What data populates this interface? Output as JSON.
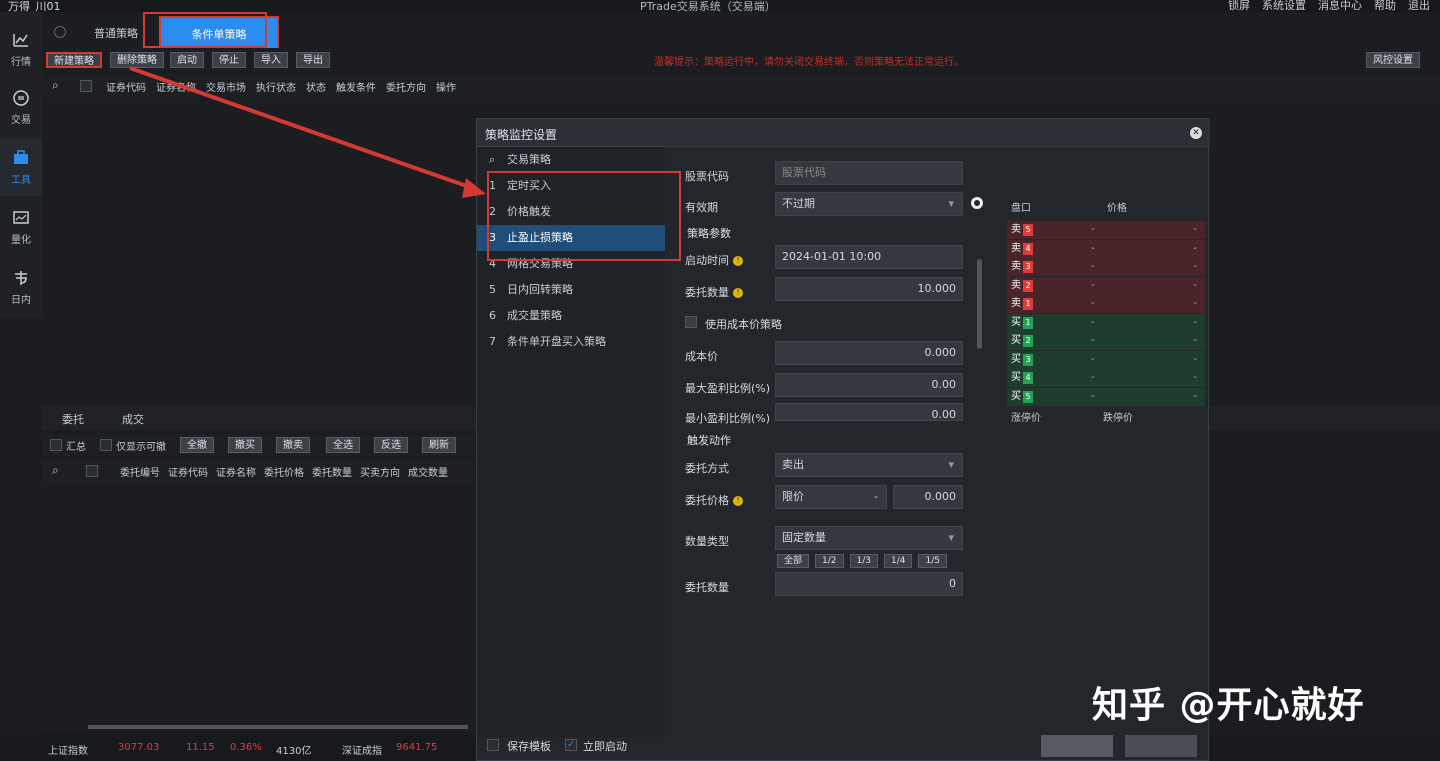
{
  "titlebar": {
    "app_name": "万得_川01",
    "window_title": "PTrade交易系统（交易端）",
    "menu": [
      "锁屏",
      "系统设置",
      "消息中心",
      "帮助",
      "退出"
    ]
  },
  "nav": [
    {
      "label": "行情",
      "icon": "chart-icon"
    },
    {
      "label": "交易",
      "icon": "exchange-icon"
    },
    {
      "label": "工具",
      "icon": "toolbox-icon"
    },
    {
      "label": "量化",
      "icon": "quant-icon"
    },
    {
      "label": "日内",
      "icon": "intraday-icon"
    }
  ],
  "tabs": {
    "tab1": "普通策略",
    "tab2_active": "条件单策略"
  },
  "toolbar": {
    "buttons": [
      "新建策略",
      "删除策略",
      "启动",
      "停止",
      "导入",
      "导出"
    ],
    "warning": "温馨提示：策略运行中，请勿关闭交易终端，否则策略无法正常运行。",
    "right_button": "风控设置"
  },
  "columns": [
    "证券代码",
    "证券名称",
    "交易市场",
    "执行状态",
    "状态",
    "触发条件",
    "委托方向",
    "操作"
  ],
  "lower": {
    "tabs": [
      "委托",
      "成交"
    ],
    "checkbox_labels": [
      "汇总",
      "仅显示可撤"
    ],
    "buttons": [
      "全撤",
      "撤买",
      "撤卖",
      "全选",
      "反选",
      "刷新"
    ],
    "columns": [
      "委托编号",
      "证券代码",
      "证券名称",
      "委托价格",
      "委托数量",
      "买卖方向",
      "成交数量"
    ]
  },
  "status": {
    "index_name": "上证指数",
    "index_value": "3077.03",
    "change": "11.15",
    "pct": "0.36%",
    "amount": "4130亿",
    "other_name": "深证成指",
    "other_value": "9641.75"
  },
  "dialog": {
    "title": "策略监控设置",
    "search_label": "交易策略",
    "strategies": [
      {
        "num": "1",
        "name": "定时买入"
      },
      {
        "num": "2",
        "name": "价格触发"
      },
      {
        "num": "3",
        "name": "止盈止损策略"
      },
      {
        "num": "4",
        "name": "网格交易策略"
      },
      {
        "num": "5",
        "name": "日内回转策略"
      },
      {
        "num": "6",
        "name": "成交量策略"
      },
      {
        "num": "7",
        "name": "条件单开盘买入策略"
      }
    ],
    "form": {
      "stock_code_label": "股票代码",
      "stock_code_placeholder": "股票代码",
      "valid_label": "有效期",
      "valid_value": "不过期",
      "section_params": "策略参数",
      "start_time_label": "启动时间",
      "start_time_value": "2024-01-01 10:00",
      "amount_label": "委托数量",
      "amount_value": "10.000",
      "use_cost_label": "使用成本价策略",
      "cost_label": "成本价",
      "cost_value": "0.000",
      "max_ratio_label": "最大盈利比例(%)",
      "max_ratio_value": "0.00",
      "min_ratio_label": "最小盈利比例(%)",
      "min_ratio_value": "0.00",
      "section_action": "触发动作",
      "trade_dir_label": "委托方式",
      "trade_dir_value": "卖出",
      "price_label": "委托价格",
      "price_type": "限价",
      "price_value": "0.000",
      "qty_type_label": "数量类型",
      "qty_type_value": "固定数量",
      "qty_shortcuts": [
        "全部",
        "1/2",
        "1/3",
        "1/4",
        "1/5"
      ],
      "qty_label": "委托数量",
      "qty_value": "0"
    },
    "order_book": {
      "header_name": "盘口",
      "header_price": "价格",
      "rows": [
        {
          "side": "卖",
          "level": "5",
          "price": "-",
          "vol": "-"
        },
        {
          "side": "卖",
          "level": "4",
          "price": "-",
          "vol": "-"
        },
        {
          "side": "卖",
          "level": "3",
          "price": "-",
          "vol": "-"
        },
        {
          "side": "卖",
          "level": "2",
          "price": "-",
          "vol": "-"
        },
        {
          "side": "卖",
          "level": "1",
          "price": "-",
          "vol": "-"
        },
        {
          "side": "买",
          "level": "1",
          "price": "-",
          "vol": "-"
        },
        {
          "side": "买",
          "level": "2",
          "price": "-",
          "vol": "-"
        },
        {
          "side": "买",
          "level": "3",
          "price": "-",
          "vol": "-"
        },
        {
          "side": "买",
          "level": "4",
          "price": "-",
          "vol": "-"
        },
        {
          "side": "买",
          "level": "5",
          "price": "-",
          "vol": "-"
        }
      ],
      "footer_left": "涨停价",
      "footer_right": "跌停价"
    },
    "bottom": {
      "check1": "保存模板",
      "check2": "立即启动"
    }
  },
  "watermark": "知乎 @开心就好",
  "colors": {
    "accent": "#2d8cf0",
    "highlight_red": "#d43a34",
    "sell": "#e03c3c",
    "buy": "#24a356"
  }
}
